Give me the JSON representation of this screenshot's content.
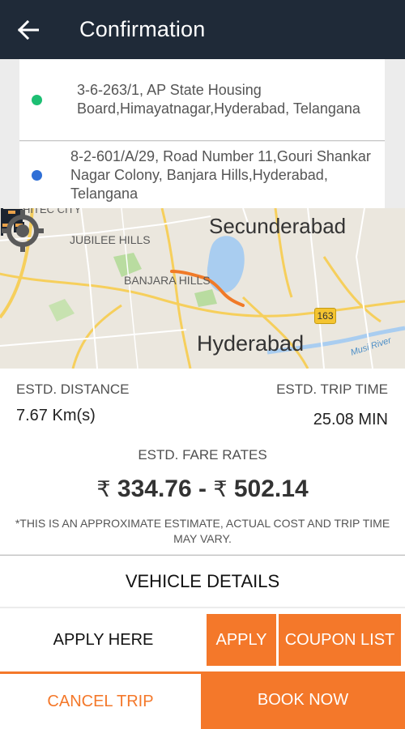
{
  "header": {
    "title": "Confirmation",
    "back_icon": "arrow-left-icon"
  },
  "colors": {
    "header_bg": "#1f2a38",
    "accent": "#f4782a",
    "pickup_dot": "#1dbf73",
    "drop_dot": "#2f6fd6"
  },
  "pickup": {
    "line1": "3-6-263/1, AP State Housing",
    "line2": "Board,Himayatnagar,Hyderabad, Telangana"
  },
  "drop": {
    "line1": "8-2-601/A/29, Road Number 11,Gouri Shankar",
    "line2": "Nagar Colony, Banjara Hills,Hyderabad, Telangana"
  },
  "map": {
    "labels": {
      "hitec": "HITEC CITY",
      "jubilee": "JUBILEE HILLS",
      "banjara": "BANJARA HILLS",
      "secunderabad": "Secunderabad",
      "hyderabad": "Hyderabad",
      "river": "Musi River",
      "highway": "163"
    },
    "icons": [
      "flag-marker-icon",
      "cab-marker-icon",
      "my-location-icon"
    ]
  },
  "estimate": {
    "distance_label": "ESTD. DISTANCE",
    "distance_value": "7.67 Km(s)",
    "time_label": "ESTD. TRIP TIME",
    "time_value": "25.08 MIN",
    "fare_label": "ESTD. FARE RATES",
    "currency": "₹",
    "fare_min": "334.76",
    "fare_sep": "-",
    "fare_max": "502.14",
    "disclaimer": "*THIS IS AN APPROXIMATE ESTIMATE, ACTUAL COST AND TRIP TIME MAY VARY."
  },
  "vehicle_details": "VEHICLE DETAILS",
  "coupon": {
    "placeholder": "APPLY HERE",
    "apply": "APPLY",
    "list": "COUPON LIST"
  },
  "actions": {
    "cancel": "CANCEL TRIP",
    "book": "BOOK NOW"
  }
}
